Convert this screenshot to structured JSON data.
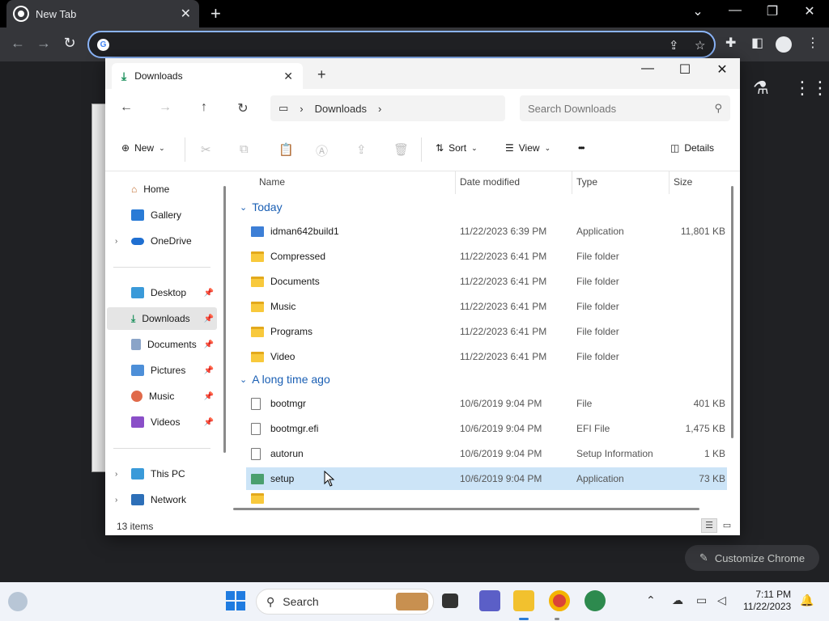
{
  "chrome": {
    "tab_title": "New Tab",
    "omnibox_value": "",
    "customize_label": "Customize Chrome"
  },
  "explorer": {
    "tab_title": "Downloads",
    "breadcrumb": [
      "Downloads"
    ],
    "search_placeholder": "Search Downloads",
    "cmd": {
      "new": "New",
      "sort": "Sort",
      "view": "View",
      "more": "•••",
      "details": "Details"
    },
    "nav": {
      "home": "Home",
      "gallery": "Gallery",
      "onedrive": "OneDrive",
      "desktop": "Desktop",
      "downloads": "Downloads",
      "documents": "Documents",
      "pictures": "Pictures",
      "music": "Music",
      "videos": "Videos",
      "thispc": "This PC",
      "network": "Network"
    },
    "columns": {
      "name": "Name",
      "date": "Date modified",
      "type": "Type",
      "size": "Size"
    },
    "groups": {
      "today": "Today",
      "long_ago": "A long time ago"
    },
    "rows": [
      {
        "name": "idman642build1",
        "date": "11/22/2023 6:39 PM",
        "type": "Application",
        "size": "11,801 KB"
      },
      {
        "name": "Compressed",
        "date": "11/22/2023 6:41 PM",
        "type": "File folder",
        "size": ""
      },
      {
        "name": "Documents",
        "date": "11/22/2023 6:41 PM",
        "type": "File folder",
        "size": ""
      },
      {
        "name": "Music",
        "date": "11/22/2023 6:41 PM",
        "type": "File folder",
        "size": ""
      },
      {
        "name": "Programs",
        "date": "11/22/2023 6:41 PM",
        "type": "File folder",
        "size": ""
      },
      {
        "name": "Video",
        "date": "11/22/2023 6:41 PM",
        "type": "File folder",
        "size": ""
      },
      {
        "name": "bootmgr",
        "date": "10/6/2019 9:04 PM",
        "type": "File",
        "size": "401 KB"
      },
      {
        "name": "bootmgr.efi",
        "date": "10/6/2019 9:04 PM",
        "type": "EFI File",
        "size": "1,475 KB"
      },
      {
        "name": "autorun",
        "date": "10/6/2019 9:04 PM",
        "type": "Setup Information",
        "size": "1 KB"
      },
      {
        "name": "setup",
        "date": "10/6/2019 9:04 PM",
        "type": "Application",
        "size": "73 KB"
      }
    ],
    "status": "13 items"
  },
  "taskbar": {
    "search_label": "Search",
    "time": "7:11 PM",
    "date": "11/22/2023"
  }
}
